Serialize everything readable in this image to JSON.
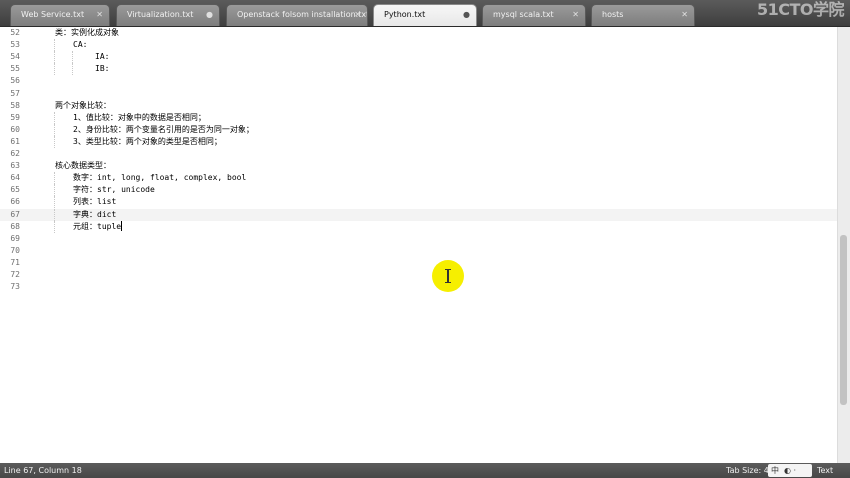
{
  "tabs": [
    {
      "label": "Web Service.txt",
      "active": false,
      "control": "✕"
    },
    {
      "label": "Virtualization.txt",
      "active": false,
      "control": "●"
    },
    {
      "label": "Openstack folsom installation.txt",
      "active": false,
      "control": "✕"
    },
    {
      "label": "Python.txt",
      "active": true,
      "control": "●"
    },
    {
      "label": "mysql scala.txt",
      "active": false,
      "control": "✕"
    },
    {
      "label": "hosts",
      "active": false,
      "control": "✕"
    }
  ],
  "watermark": "51CTO学院",
  "editor": {
    "current_line": 67,
    "lines": [
      {
        "n": "52",
        "text": "类：实例化成对象",
        "indent": 0
      },
      {
        "n": "53",
        "text": "CA:",
        "indent": 1
      },
      {
        "n": "54",
        "text": "IA:",
        "indent": 2
      },
      {
        "n": "55",
        "text": "IB:",
        "indent": 2
      },
      {
        "n": "56",
        "text": "",
        "indent": 0
      },
      {
        "n": "57",
        "text": "",
        "indent": 0
      },
      {
        "n": "58",
        "text": "两个对象比较：",
        "indent": 0
      },
      {
        "n": "59",
        "text": "1、值比较：对象中的数据是否相同；",
        "indent": 1
      },
      {
        "n": "60",
        "text": "2、身份比较：两个变量名引用的是否为同一对象；",
        "indent": 1
      },
      {
        "n": "61",
        "text": "3、类型比较：两个对象的类型是否相同；",
        "indent": 1
      },
      {
        "n": "62",
        "text": "",
        "indent": 0
      },
      {
        "n": "63",
        "text": "核心数据类型：",
        "indent": 0
      },
      {
        "n": "64",
        "text": "数字：int, long, float, complex, bool",
        "indent": 1
      },
      {
        "n": "65",
        "text": "字符：str, unicode",
        "indent": 1
      },
      {
        "n": "66",
        "text": "列表：list",
        "indent": 1
      },
      {
        "n": "67",
        "text": "字典：dict",
        "indent": 1
      },
      {
        "n": "68",
        "text": "元组：tuple",
        "indent": 1
      },
      {
        "n": "69",
        "text": "",
        "indent": 0
      },
      {
        "n": "70",
        "text": "",
        "indent": 0
      },
      {
        "n": "71",
        "text": "",
        "indent": 0
      },
      {
        "n": "72",
        "text": "",
        "indent": 0
      },
      {
        "n": "73",
        "text": "",
        "indent": 0
      }
    ]
  },
  "statusbar": {
    "position": "Line 67, Column 18",
    "tab_size": "Tab Size: 4",
    "syntax": "Text",
    "ime_label": "中",
    "ime_icons": "◐ ·"
  }
}
